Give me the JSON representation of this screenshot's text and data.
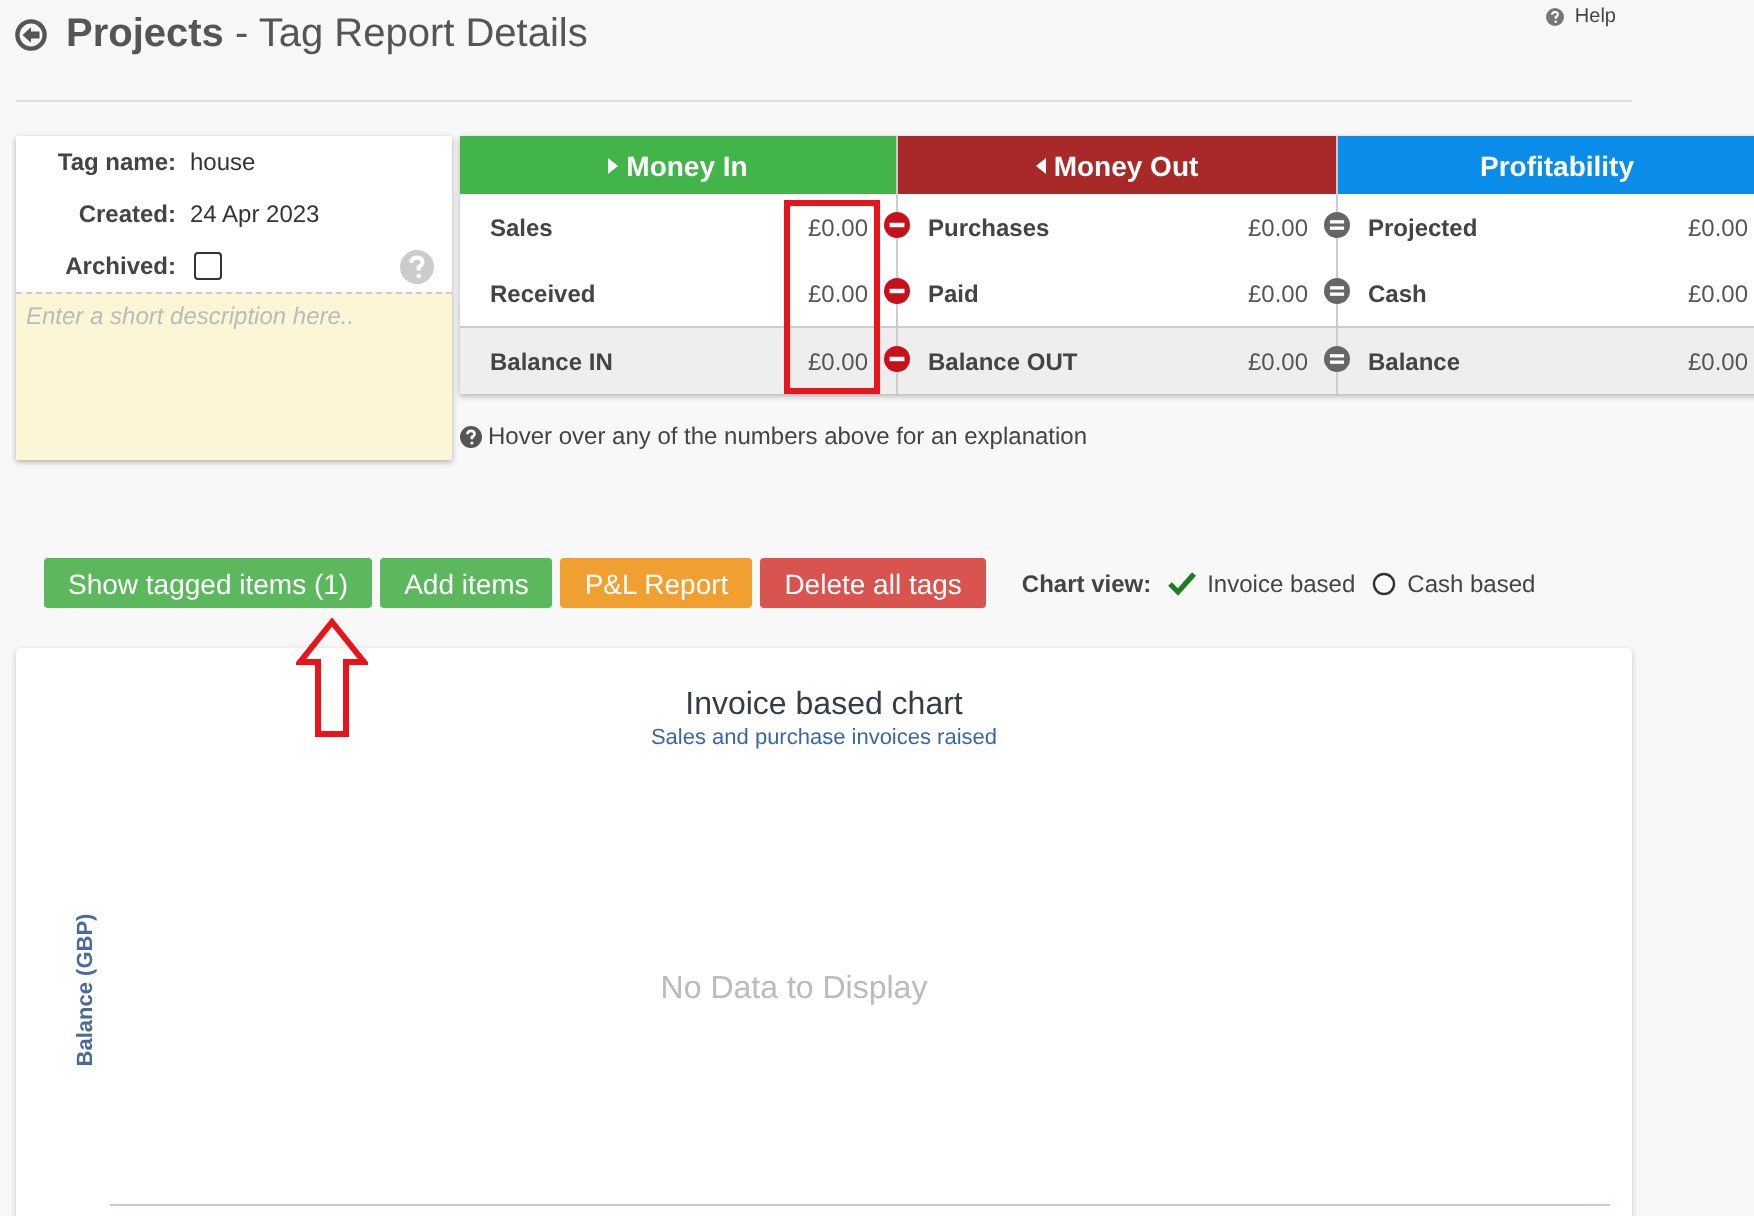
{
  "header": {
    "title_bold": "Projects",
    "title_rest": "- Tag Report Details",
    "help": "Help"
  },
  "tag": {
    "fields": [
      {
        "label": "Tag name:",
        "value": "house"
      },
      {
        "label": "Created:",
        "value": "24 Apr 2023"
      }
    ],
    "archived": {
      "label": "Archived:",
      "checked": false
    },
    "description": {
      "placeholder": "Enter a short description here.."
    }
  },
  "summary": {
    "columns": [
      {
        "title": "Money In",
        "color": "#42b449",
        "kind": "in",
        "rows": [
          {
            "label": "Sales",
            "value": "£0.00"
          },
          {
            "label": "Received",
            "value": "£0.00"
          },
          {
            "label": "Balance IN",
            "value": "£0.00"
          }
        ]
      },
      {
        "title": "Money Out",
        "color": "#a92828",
        "kind": "out",
        "rows": [
          {
            "label": "Purchases",
            "value": "£0.00"
          },
          {
            "label": "Paid",
            "value": "£0.00"
          },
          {
            "label": "Balance OUT",
            "value": "£0.00"
          }
        ]
      },
      {
        "title": "Profitability",
        "color": "#0a8de8",
        "kind": "profit",
        "rows": [
          {
            "label": "Projected",
            "value": "£0.00"
          },
          {
            "label": "Cash",
            "value": "£0.00"
          },
          {
            "label": "Balance",
            "value": "£0.00"
          }
        ]
      }
    ],
    "note": "Hover over any of the numbers above for an explanation"
  },
  "buttons": [
    {
      "label": "Show tagged items (1)",
      "color": "#5cb85c"
    },
    {
      "label": "Add items",
      "color": "#5cb85c"
    },
    {
      "label": "P&L Report",
      "color": "#f0a030"
    },
    {
      "label": "Delete all tags",
      "color": "#d9534f"
    }
  ],
  "chart_view": {
    "label": "Chart view:",
    "options": [
      {
        "label": "Invoice based",
        "selected": true
      },
      {
        "label": "Cash based",
        "selected": false
      }
    ]
  },
  "chart": {
    "title": "Invoice based chart",
    "subtitle": "Sales and purchase invoices raised",
    "ylabel": "Balance (GBP)",
    "message": "No Data to Display"
  }
}
